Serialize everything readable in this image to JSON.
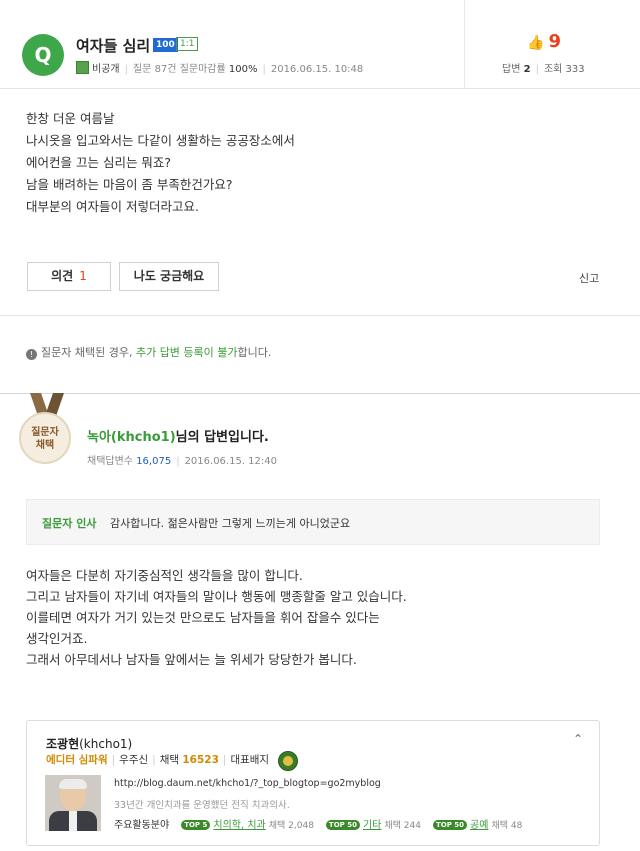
{
  "question": {
    "logo_letter": "Q",
    "title": "여자들 심리",
    "badge_level": "100",
    "badge_type": "1:1",
    "visibility": "비공개",
    "question_count": "질문 87건",
    "closing_rate_label": "질문마감률",
    "closing_rate": "100%",
    "date": "2016.06.15. 10:48",
    "likes": "9",
    "answers_label": "답변",
    "answers_count": "2",
    "views_label": "조회",
    "views_count": "333",
    "body": [
      "한창 더운 여름날",
      "나시옷을 입고와서는 다같이 생활하는 공공장소에서",
      "에어컨을 끄는 심리는 뭐죠?",
      "남을 배려하는 마음이 좀 부족한건가요?",
      "대부분의 여자들이 저렇더라고요."
    ],
    "opinion_label": "의견",
    "opinion_count": "1",
    "curious_label": "나도 궁금해요",
    "report_label": "신고"
  },
  "notice": {
    "part1": "질문자 채택된 경우, ",
    "highlight": "추가 답변 등록이 불가",
    "part2": "합니다."
  },
  "answer": {
    "medal_line1": "질문자",
    "medal_line2": "채택",
    "author_name": "녹아(khcho1)",
    "title_suffix": "님의 답변입니다.",
    "adopted_label": "채택답변수",
    "adopted_count": "16,075",
    "date": "2016.06.15. 12:40",
    "thanks_label": "질문자 인사",
    "thanks_text": "감사합니다. 젊은사람만 그렇게 느끼는게 아니었군요",
    "body": [
      "여자들은 다분히 자기중심적인 생각들을 많이 합니다.",
      "그리고 남자들이 자기네 여자들의 말이나 행동에 맹종할줄 알고 있습니다.",
      "이를테면 여자가 거기 있는것 만으로도 남자들을 휘어 잡을수 있다는",
      "생각인거죠.",
      "그래서 아무데서나 남자들 앞에서는 늘 위세가 당당한가 봅니다."
    ]
  },
  "profile": {
    "name": "조광현",
    "id": "(khcho1)",
    "role": "에디터 심파워",
    "rank": "우주신",
    "adopt_label": "채택",
    "adopt_count": "16523",
    "badge_label": "대표배지",
    "url": "http://blog.daum.net/khcho1/?_top_blogtop=go2myblog",
    "description": "33년간 개인치과를 운영했던 전직 치과의사.",
    "fields_label": "주요활동분야",
    "fields": [
      {
        "tag": "TOP 5",
        "name": "치의학, 치과",
        "count": "채택 2,048"
      },
      {
        "tag": "TOP 50",
        "name": "기타",
        "count": "채택 244"
      },
      {
        "tag": "TOP 50",
        "name": "공예",
        "count": "채택 48"
      }
    ]
  }
}
